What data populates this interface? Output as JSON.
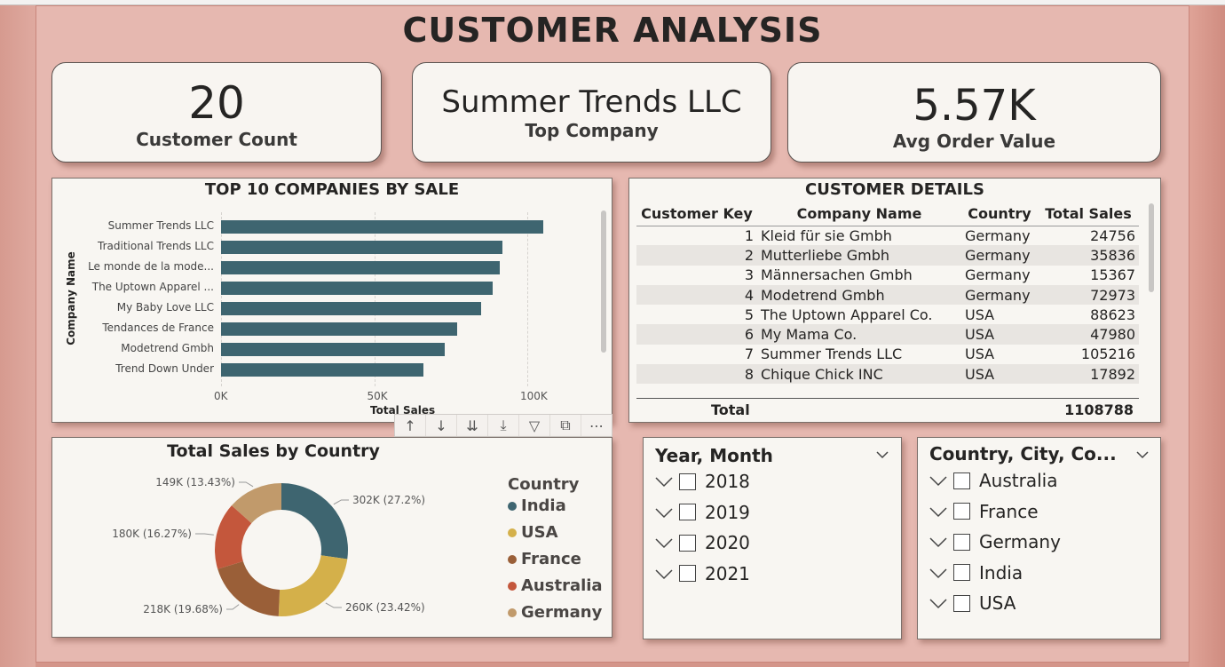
{
  "page_title": "CUSTOMER ANALYSIS",
  "kpis": {
    "customer_count": {
      "value": "20",
      "label": "Customer Count"
    },
    "top_company": {
      "value": "Summer Trends LLC",
      "label": "Top Company"
    },
    "avg_order": {
      "value": "5.57K",
      "label": "Avg Order Value"
    }
  },
  "bar_chart": {
    "title": "TOP 10 COMPANIES BY SALE",
    "ylabel": "Company Name",
    "xlabel": "Total Sales",
    "ticks": [
      "0K",
      "50K",
      "100K"
    ]
  },
  "donut": {
    "title": "Total Sales by Country",
    "legend_title": "Country",
    "labels": [
      "302K (27.2%)",
      "260K (23.42%)",
      "218K (19.68%)",
      "180K (16.27%)",
      "149K (13.43%)"
    ]
  },
  "details": {
    "title": "CUSTOMER DETAILS",
    "headers": [
      "Customer Key",
      "Company Name",
      "Country",
      "Total Sales"
    ],
    "rows": [
      [
        "1",
        "Kleid für sie Gmbh",
        "Germany",
        "24756"
      ],
      [
        "2",
        "Mutterliebe Gmbh",
        "Germany",
        "35836"
      ],
      [
        "3",
        "Männersachen Gmbh",
        "Germany",
        "15367"
      ],
      [
        "4",
        "Modetrend Gmbh",
        "Germany",
        "72973"
      ],
      [
        "5",
        "The Uptown Apparel Co.",
        "USA",
        "88623"
      ],
      [
        "6",
        "My Mama Co.",
        "USA",
        "47980"
      ],
      [
        "7",
        "Summer Trends LLC",
        "USA",
        "105216"
      ],
      [
        "8",
        "Chique Chick INC",
        "USA",
        "17892"
      ]
    ],
    "total_label": "Total",
    "total_value": "1108788"
  },
  "slicer_year": {
    "title": "Year, Month",
    "items": [
      "2018",
      "2019",
      "2020",
      "2021"
    ]
  },
  "slicer_country": {
    "title": "Country, City, Co...",
    "items": [
      "Australia",
      "France",
      "Germany",
      "India",
      "USA"
    ]
  },
  "colors": {
    "bar": "#3e6570",
    "india": "#3e6570",
    "usa": "#d4b04a",
    "france": "#9a5f38",
    "australia": "#c4573c",
    "germany": "#c19a6b"
  },
  "chart_data": [
    {
      "type": "bar",
      "title": "TOP 10 COMPANIES BY SALE",
      "xlabel": "Total Sales",
      "ylabel": "Company Name",
      "categories": [
        "Summer Trends LLC",
        "Traditional Trends LLC",
        "Le monde de la mode...",
        "The Uptown Apparel ...",
        "My Baby Love LLC",
        "Tendances de France",
        "Modetrend Gmbh",
        "Trend Down Under"
      ],
      "values": [
        105216,
        92000,
        91000,
        88623,
        85000,
        77000,
        72973,
        66000
      ],
      "xlim": [
        0,
        120000
      ]
    },
    {
      "type": "pie",
      "title": "Total Sales by Country",
      "categories": [
        "India",
        "USA",
        "France",
        "Australia",
        "Germany"
      ],
      "values": [
        302000,
        260000,
        218000,
        180000,
        149000
      ],
      "percent": [
        27.2,
        23.42,
        19.68,
        16.27,
        13.43
      ],
      "legend": "right"
    }
  ]
}
